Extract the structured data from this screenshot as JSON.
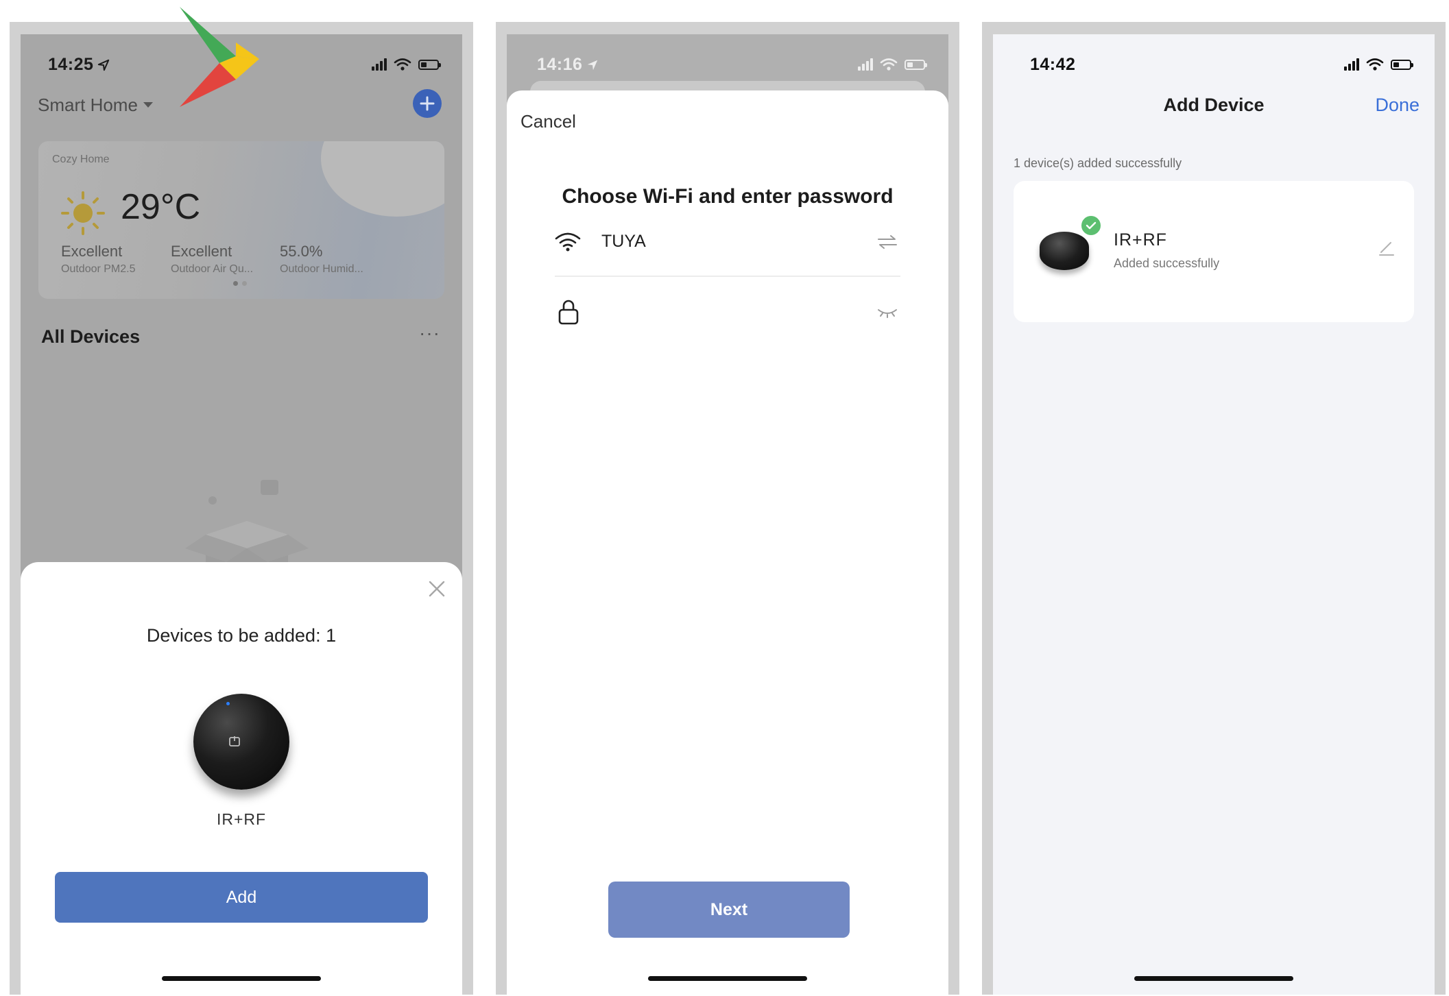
{
  "screen1": {
    "status_time": "14:25",
    "home_selector": "Smart Home",
    "weather": {
      "home_name": "Cozy Home",
      "temperature": "29°C",
      "metrics": [
        {
          "value": "Excellent",
          "label": "Outdoor PM2.5"
        },
        {
          "value": "Excellent",
          "label": "Outdoor Air Qu..."
        },
        {
          "value": "55.0%",
          "label": "Outdoor Humid..."
        }
      ]
    },
    "section_title": "All Devices",
    "more_label": "···",
    "sheet": {
      "title": "Devices to be added: 1",
      "device_name": "IR+RF",
      "add_label": "Add"
    }
  },
  "screen2": {
    "status_time": "14:16",
    "cancel_label": "Cancel",
    "heading": "Choose Wi-Fi and enter password",
    "wifi_name": "TUYA",
    "password_value": "",
    "next_label": "Next"
  },
  "screen3": {
    "status_time": "14:42",
    "title": "Add Device",
    "done_label": "Done",
    "summary": "1 device(s) added successfully",
    "device": {
      "name": "IR+RF",
      "status": "Added successfully"
    }
  },
  "colors": {
    "accent_blue": "#4f75bd",
    "next_button": "#7289c4",
    "done_link": "#3a6fd8",
    "success_green": "#5cbf70",
    "dim_overlay": "#a5a5a5"
  },
  "icons": [
    "location-arrow-icon",
    "signal-icon",
    "wifi-icon",
    "battery-icon",
    "plus-icon",
    "sun-icon",
    "close-icon",
    "switch-network-icon",
    "lock-icon",
    "eye-closed-icon",
    "check-icon",
    "edit-icon",
    "play-store-logo"
  ]
}
